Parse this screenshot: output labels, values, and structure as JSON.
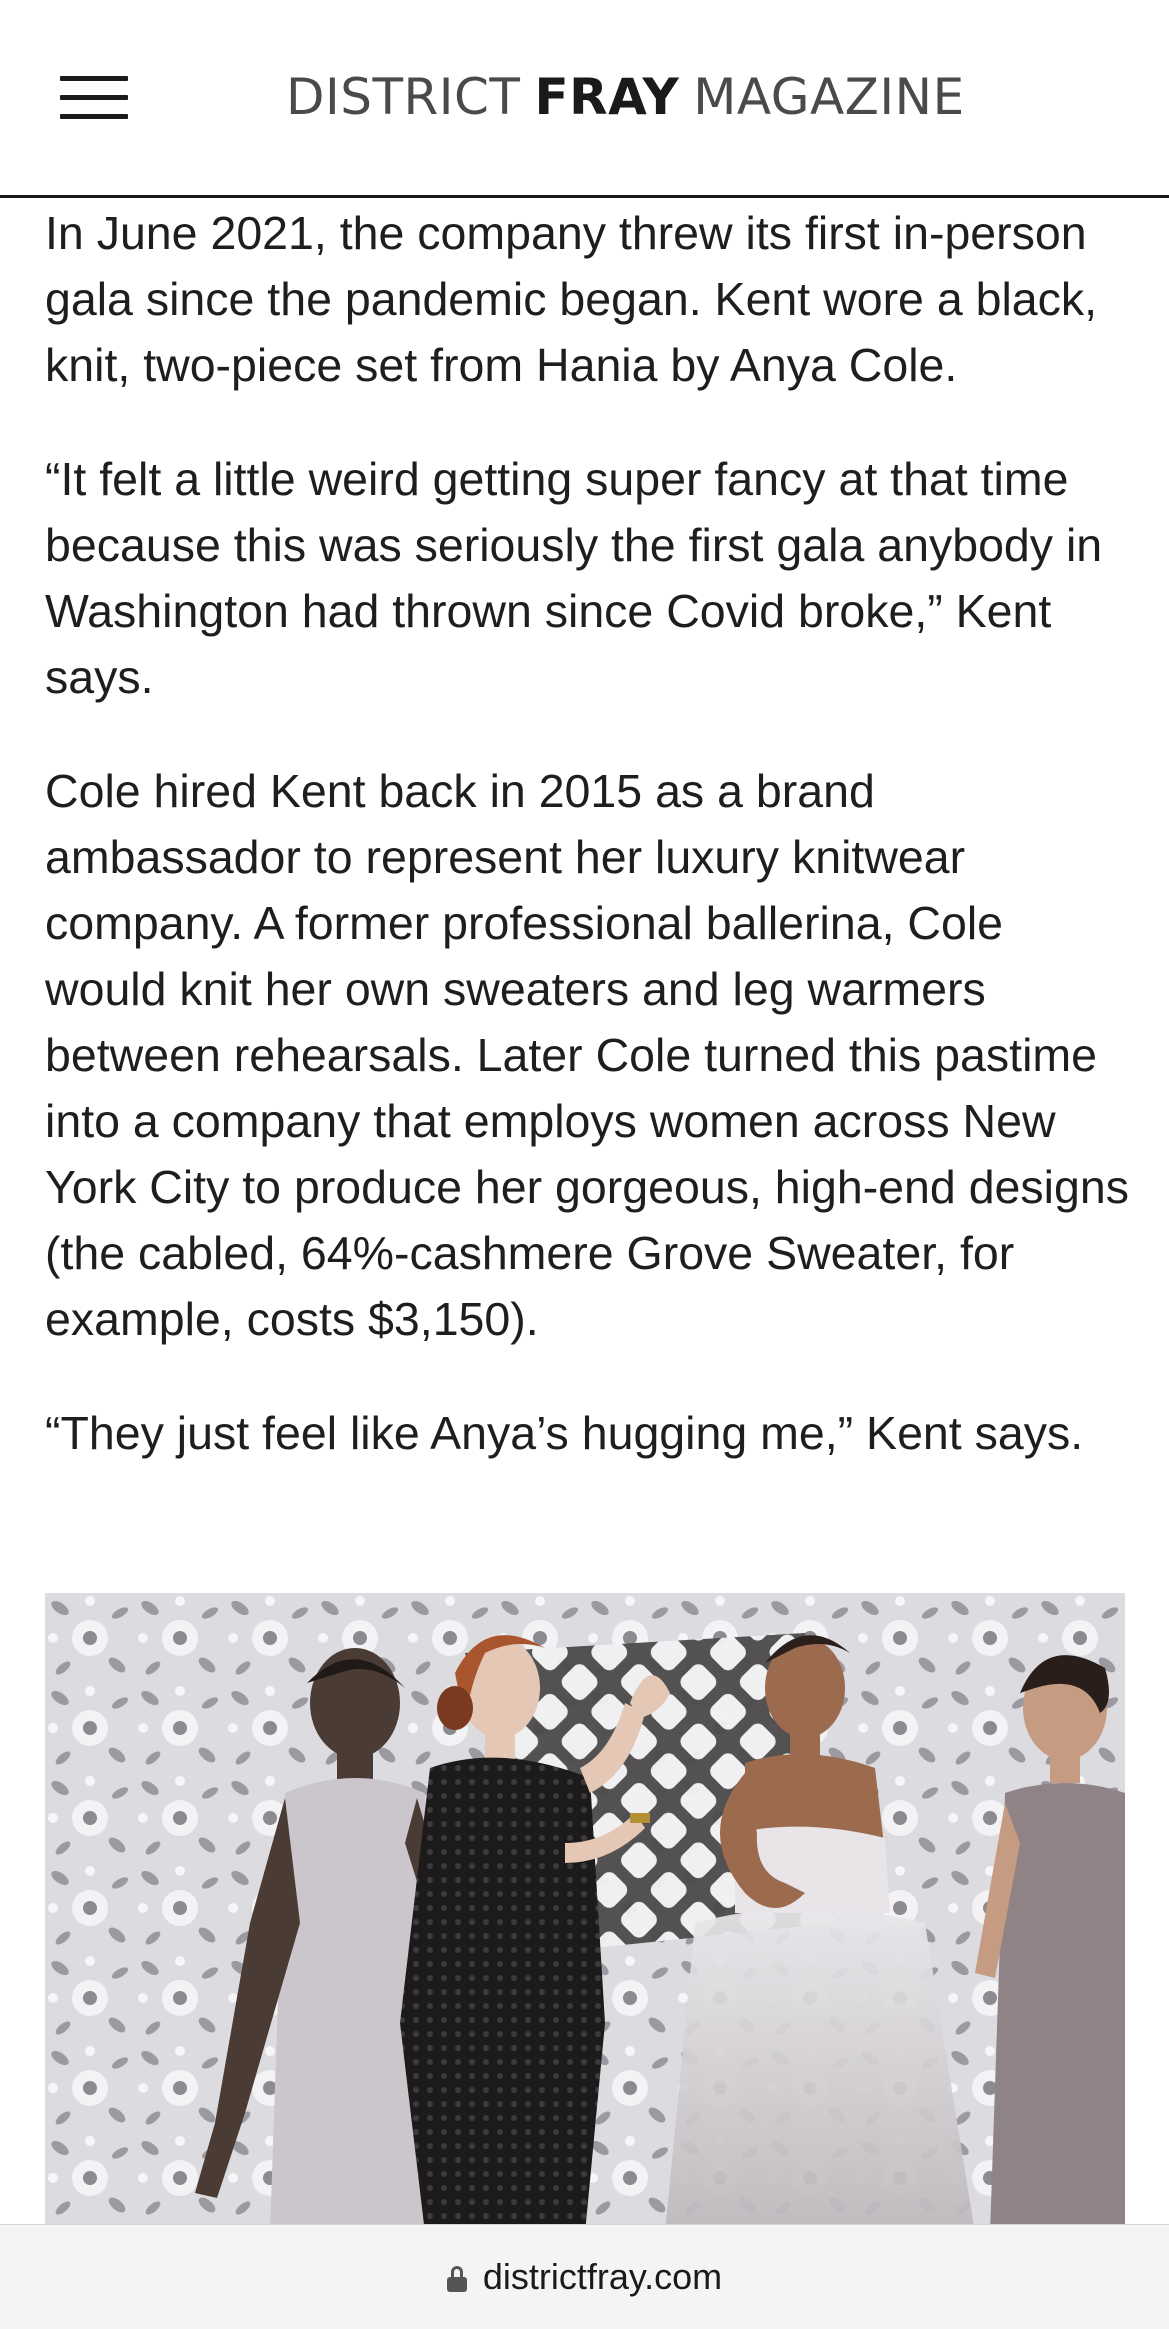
{
  "header": {
    "logo_part1": "DISTRICT",
    "logo_part2": "FRAY",
    "logo_part3": "MAGAZINE"
  },
  "article": {
    "paragraphs": [
      "In June 2021, the company threw its first in-person gala since the pandemic began. Kent wore a black, knit, two-piece set from Hania by Anya Cole.",
      "“It felt a little weird getting super fancy at that time because this was seriously the first gala anybody in Washington had thrown since Covid broke,” Kent says.",
      "Cole hired Kent back in 2015 as a brand ambassador to represent her luxury knitwear company. A former professional ballerina, Cole would knit her own sweaters and leg warmers between rehearsals. Later Cole turned this pastime into a company that employs women across New York City to produce her gorgeous, high-end designs (the cabled, 64%-cashmere Grove Sweater, for example, costs $3,150).",
      "“They just feel like Anya’s hugging me,” Kent says."
    ]
  },
  "browser": {
    "url": "districtfray.com"
  }
}
